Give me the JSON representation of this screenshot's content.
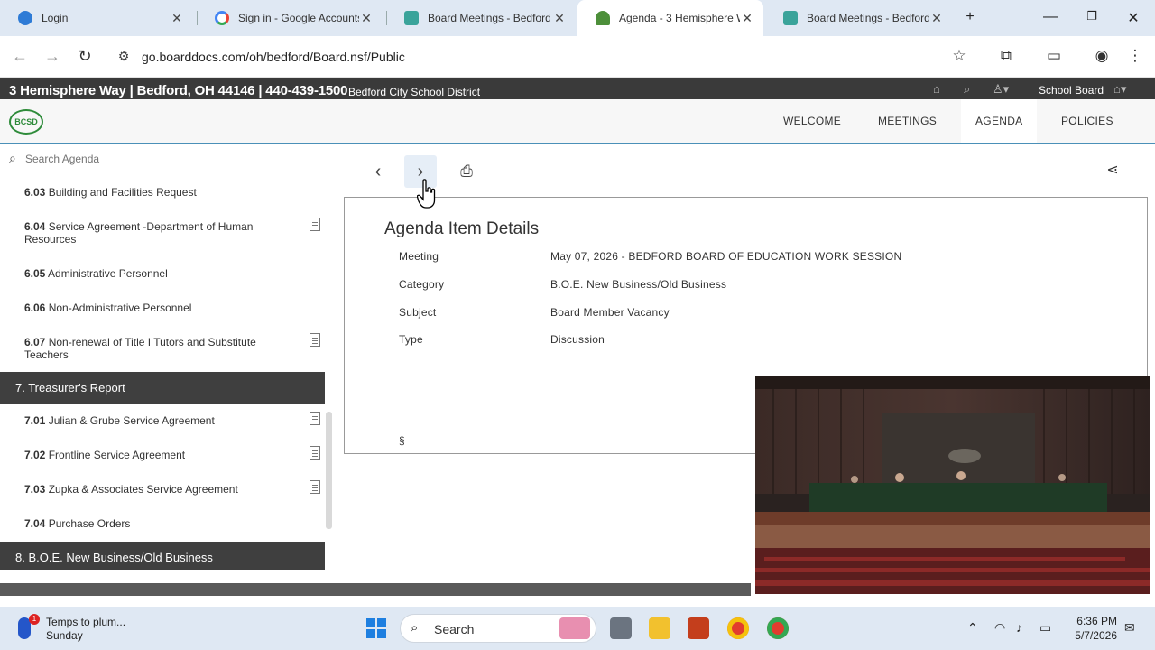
{
  "browser": {
    "tabs": [
      {
        "label": "Login",
        "icon": "cloud-icon"
      },
      {
        "label": "Sign in - Google Accounts",
        "icon": "google-icon"
      },
      {
        "label": "Board Meetings - Bedford",
        "icon": "boarddocs-icon"
      },
      {
        "label": "Agenda - 3 Hemisphere W",
        "icon": "tree-icon"
      },
      {
        "label": "Board Meetings - Bedford",
        "icon": "boarddocs-icon"
      }
    ],
    "url": "go.boarddocs.com/oh/bedford/Board.nsf/Public"
  },
  "site": {
    "address": "3 Hemisphere Way | Bedford, OH 44146 | 440-439-1500",
    "district": "Bedford City School District",
    "board_label": "School Board",
    "logo_text": "BCSD",
    "nav": [
      "WELCOME",
      "MEETINGS",
      "AGENDA",
      "POLICIES"
    ]
  },
  "sidebar": {
    "search_placeholder": "Search Agenda",
    "items": [
      {
        "num": "6.03",
        "label": "Building and Facilities Request"
      },
      {
        "num": "6.04",
        "label": "Service Agreement -Department of Human Resources"
      },
      {
        "num": "6.05",
        "label": "Administrative Personnel"
      },
      {
        "num": "6.06",
        "label": "Non-Administrative Personnel"
      },
      {
        "num": "6.07",
        "label": "Non-renewal of Title I Tutors and Substitute Teachers"
      },
      {
        "num": "7.01",
        "label": "Julian & Grube Service Agreement"
      },
      {
        "num": "7.02",
        "label": "Frontline Service Agreement"
      },
      {
        "num": "7.03",
        "label": "Zupka & Associates Service Agreement"
      },
      {
        "num": "7.04",
        "label": "Purchase Orders"
      }
    ],
    "sections": [
      "7. Treasurer's Report",
      "8. B.O.E. New Business/Old Business"
    ]
  },
  "details": {
    "title": "Agenda Item Details",
    "meeting_label": "Meeting",
    "meeting_value": "May 07, 2026 - BEDFORD BOARD OF EDUCATION WORK SESSION",
    "category_label": "Category",
    "category_value": "B.O.E. New Business/Old Business",
    "subject_label": "Subject",
    "subject_value": "Board Member Vacancy",
    "type_label": "Type",
    "type_value": "Discussion",
    "section_mark": "§"
  },
  "taskbar": {
    "weather_line1": "Temps to plum...",
    "weather_line2": "Sunday",
    "weather_badge": "1",
    "search_label": "Search",
    "time": "6:36 PM",
    "date": "5/7/2026"
  }
}
